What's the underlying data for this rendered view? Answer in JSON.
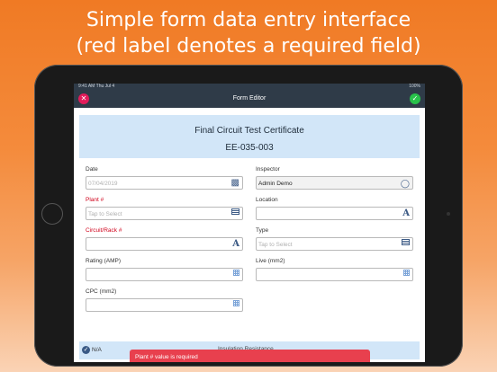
{
  "headline": {
    "line1": "Simple form data entry interface",
    "line2": "(red label denotes a required field)"
  },
  "statusbar": {
    "left": "9:41 AM  Thu Jul 4",
    "right": "100%"
  },
  "navbar": {
    "title": "Form Editor",
    "close_icon": "close-icon",
    "done_icon": "checkmark-icon"
  },
  "certificate": {
    "title": "Final Circuit Test Certificate",
    "number": "EE-035-003"
  },
  "fields": {
    "date": {
      "label": "Date",
      "value": "07/04/2019",
      "icon": "calendar-icon"
    },
    "inspector": {
      "label": "Inspector",
      "value": "Admin Demo",
      "icon": "user-icon"
    },
    "plant": {
      "label": "Plant #",
      "placeholder": "Tap to Select",
      "icon": "list-icon",
      "required": true
    },
    "location": {
      "label": "Location",
      "icon": "text-icon"
    },
    "circuit": {
      "label": "Circuit/Rack #",
      "icon": "text-icon",
      "required": true
    },
    "type": {
      "label": "Type",
      "placeholder": "Tap to Select",
      "icon": "list-icon"
    },
    "rating": {
      "label": "Rating (AMP)",
      "icon": "number-pad-icon"
    },
    "live": {
      "label": "Live (mm2)",
      "icon": "number-pad-icon"
    },
    "cpc": {
      "label": "CPC (mm2)",
      "icon": "number-pad-icon"
    }
  },
  "section": {
    "na_label": "N/A",
    "title_fragment": "Insulation Resistance"
  },
  "toast": {
    "message": "Plant # value is required"
  },
  "colors": {
    "accent": "#2f3b48",
    "required": "#d0021b",
    "toast": "#e8404e",
    "cert_bg": "#d2e6f8"
  }
}
